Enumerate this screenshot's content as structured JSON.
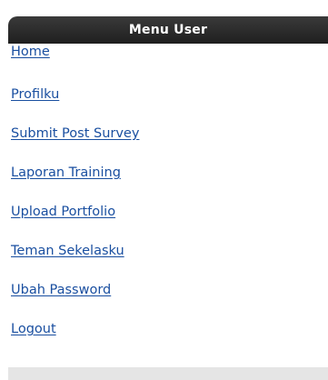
{
  "menu": {
    "title": "Menu User",
    "items": [
      {
        "label": "Home"
      },
      {
        "label": "Profilku"
      },
      {
        "label": "Submit Post Survey"
      },
      {
        "label": "Laporan Training"
      },
      {
        "label": "Upload Portfolio"
      },
      {
        "label": "Teman Sekelasku"
      },
      {
        "label": "Ubah Password"
      },
      {
        "label": "Logout"
      }
    ]
  },
  "colors": {
    "header_bg": "#2a2a2a",
    "header_text": "#ffffff",
    "link": "#1a4fa0",
    "footer_bg": "#e5e5e5"
  }
}
